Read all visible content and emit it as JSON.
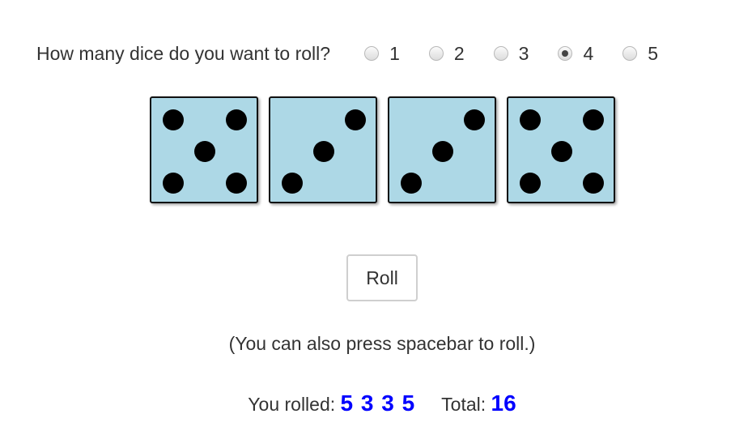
{
  "question": "How many dice do you want to roll?",
  "options": [
    "1",
    "2",
    "3",
    "4",
    "5"
  ],
  "selected_option": "4",
  "dice": [
    5,
    3,
    3,
    5
  ],
  "die_color": "#add8e6",
  "roll_button": "Roll",
  "hint": "(You can also press spacebar to roll.)",
  "result": {
    "label": "You rolled:",
    "values": "5 3 3 5",
    "total_label": "Total:",
    "total": "16"
  },
  "accent_color": "#0000ff"
}
